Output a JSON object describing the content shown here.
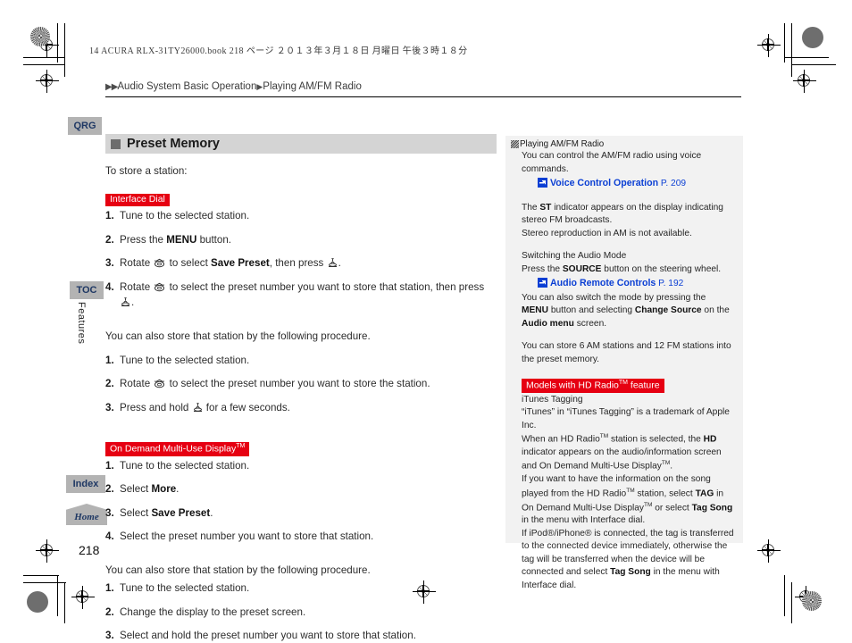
{
  "print_header": "14 ACURA RLX-31TY26000.book   218 ページ   ２０１３年３月１８日   月曜日   午後３時１８分",
  "breadcrumb": {
    "lead": "▶▶",
    "parent": "Audio System Basic Operation",
    "sep": "▶",
    "child": "Playing AM/FM Radio"
  },
  "tabs": {
    "qrg": "QRG",
    "toc": "TOC",
    "features": "Features",
    "index": "Index",
    "home": "Home"
  },
  "folio": "218",
  "colors": {
    "red_tag": "#e60012",
    "xref_blue": "#0b3fd4",
    "tab_gray": "#b3b3b3",
    "section_gray": "#d4d4d4",
    "panel_gray": "#f2f2f2"
  },
  "main": {
    "section_title": "Preset Memory",
    "intro": "To store a station:",
    "group1": {
      "tag": "Interface Dial",
      "steps": [
        {
          "n": "1.",
          "text": "Tune to the selected station."
        },
        {
          "n": "2.",
          "pre": "Press the ",
          "bold": "MENU",
          "post": " button."
        },
        {
          "n": "3.",
          "pre": "Rotate ",
          "icon1": "dial-rotate-icon",
          "mid": " to select ",
          "bold": "Save Preset",
          "post": ", then press ",
          "icon2": "dial-press-icon",
          "end": "."
        },
        {
          "n": "4.",
          "pre": "Rotate ",
          "icon1": "dial-rotate-icon",
          "mid": " to select the preset number you want to store that station, then press ",
          "icon2": "dial-press-icon",
          "end": "."
        }
      ]
    },
    "alt_note1": "You can also store that station by the following procedure.",
    "group2": {
      "steps": [
        {
          "n": "1.",
          "text": "Tune to the selected station."
        },
        {
          "n": "2.",
          "pre": "Rotate ",
          "icon1": "dial-rotate-icon",
          "mid": " to select the preset number you want to store the station."
        },
        {
          "n": "3.",
          "pre": "Press and hold ",
          "icon1": "dial-press-icon",
          "mid": " for a few seconds."
        }
      ]
    },
    "group3": {
      "tag": "On Demand Multi-Use Display",
      "tag_tm": "TM",
      "steps": [
        {
          "n": "1.",
          "text": "Tune to the selected station."
        },
        {
          "n": "2.",
          "pre": "Select ",
          "bold": "More",
          "post": "."
        },
        {
          "n": "3.",
          "pre": "Select ",
          "bold": "Save Preset",
          "post": "."
        },
        {
          "n": "4.",
          "text": "Select the preset number you want to store that station."
        }
      ]
    },
    "alt_note2": "You can also store that station by the following procedure.",
    "group4": {
      "steps": [
        {
          "n": "1.",
          "text": "Tune to the selected station."
        },
        {
          "n": "2.",
          "text": "Change the display to the preset screen."
        },
        {
          "n": "3.",
          "text": "Select and hold the preset number you want to store that station."
        }
      ]
    }
  },
  "sidebar": {
    "header": "Playing AM/FM Radio",
    "voice_para": "You can control the AM/FM radio using voice commands.",
    "xref1": {
      "label": "Voice Control Operation",
      "page": "P. 209"
    },
    "st_para_1_pre": "The ",
    "st_para_1_bold": "ST",
    "st_para_1_post": " indicator appears on the display indicating stereo FM broadcasts.",
    "st_para_2": "Stereo reproduction in AM is not available.",
    "audio_mode_title": "Switching the Audio Mode",
    "audio_mode_pre": "Press the ",
    "audio_mode_bold": "SOURCE",
    "audio_mode_post": " button on the steering wheel.",
    "xref2": {
      "label": "Audio Remote Controls",
      "page": "P. 192"
    },
    "switch_mode_a": "You can also switch the mode by pressing the ",
    "switch_mode_b": "MENU",
    "switch_mode_c": " button and selecting ",
    "switch_mode_d": "Change Source",
    "switch_mode_e": " on the ",
    "switch_mode_f": "Audio menu",
    "switch_mode_g": " screen.",
    "preset_capacity": "You can store 6 AM stations and 12 FM stations into the preset memory.",
    "hd_tag": "Models with HD Radio",
    "hd_tag_tm": "TM",
    "hd_tag_suffix": " feature",
    "itunes_title": "iTunes Tagging",
    "itunes_trademark": "“iTunes” in “iTunes Tagging” is a trademark of Apple Inc.",
    "hd_line_1a": "When an HD Radio",
    "hd_line_1b": " station is selected, the ",
    "hd_line_1c": "HD",
    "hd_line_1d": " indicator appears on the audio/information screen and On Demand Multi-Use Display",
    "hd_line_1e": ".",
    "hd_line_2a": "If you want to have the information on the song played from the HD Radio",
    "hd_line_2b": " station, select ",
    "hd_line_2c": "TAG",
    "hd_line_2d": " in On Demand Multi-Use Display",
    "hd_line_2e": " or select ",
    "hd_line_2f": "Tag Song",
    "hd_line_2g": " in the menu with Interface dial.",
    "ipod_line_a": "If iPod®/iPhone® is connected, the tag is transferred to the connected device immediately, otherwise the tag will be transferred when the device will be connected and select ",
    "ipod_line_b": "Tag Song",
    "ipod_line_c": " in the menu with Interface dial."
  }
}
